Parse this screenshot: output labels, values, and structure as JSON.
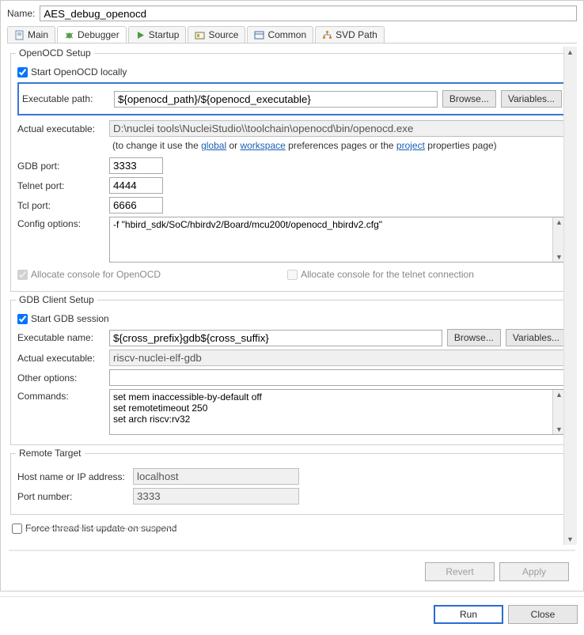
{
  "name_label": "Name:",
  "name_value": "AES_debug_openocd",
  "tabs": [
    {
      "label": "Main"
    },
    {
      "label": "Debugger"
    },
    {
      "label": "Startup"
    },
    {
      "label": "Source"
    },
    {
      "label": "Common"
    },
    {
      "label": "SVD Path"
    }
  ],
  "openocd": {
    "legend": "OpenOCD Setup",
    "start_locally": "Start OpenOCD locally",
    "exec_path_label": "Executable path:",
    "exec_path_value": "${openocd_path}/${openocd_executable}",
    "browse": "Browse...",
    "variables": "Variables...",
    "actual_exec_label": "Actual executable:",
    "actual_exec_value": "D:\\nuclei tools\\NucleiStudio\\\\toolchain\\openocd\\bin/openocd.exe",
    "note_pre": "(to change it use the ",
    "note_global": "global",
    "note_or": " or ",
    "note_workspace": "workspace",
    "note_mid": " preferences pages or the ",
    "note_project": "project",
    "note_post": " properties page)",
    "gdb_port_label": "GDB port:",
    "gdb_port_value": "3333",
    "telnet_port_label": "Telnet port:",
    "telnet_port_value": "4444",
    "tcl_port_label": "Tcl port:",
    "tcl_port_value": "6666",
    "config_label": "Config options:",
    "config_value": "-f \"hbird_sdk/SoC/hbirdv2/Board/mcu200t/openocd_hbirdv2.cfg\"",
    "alloc_openocd": "Allocate console for OpenOCD",
    "alloc_telnet": "Allocate console for the telnet connection"
  },
  "gdb": {
    "legend": "GDB Client Setup",
    "start_session": "Start GDB session",
    "exec_name_label": "Executable name:",
    "exec_name_value": "${cross_prefix}gdb${cross_suffix}",
    "browse": "Browse...",
    "variables": "Variables...",
    "actual_exec_label": "Actual executable:",
    "actual_exec_value": "riscv-nuclei-elf-gdb",
    "other_label": "Other options:",
    "other_value": "",
    "commands_label": "Commands:",
    "commands_value": "set mem inaccessible-by-default off\nset remotetimeout 250\nset arch riscv:rv32"
  },
  "remote": {
    "legend": "Remote Target",
    "host_label": "Host name or IP address:",
    "host_value": "localhost",
    "port_label": "Port number:",
    "port_value": "3333"
  },
  "cutoff_text": "Force thread list update on suspend",
  "buttons": {
    "revert": "Revert",
    "apply": "Apply",
    "run": "Run",
    "close": "Close"
  }
}
